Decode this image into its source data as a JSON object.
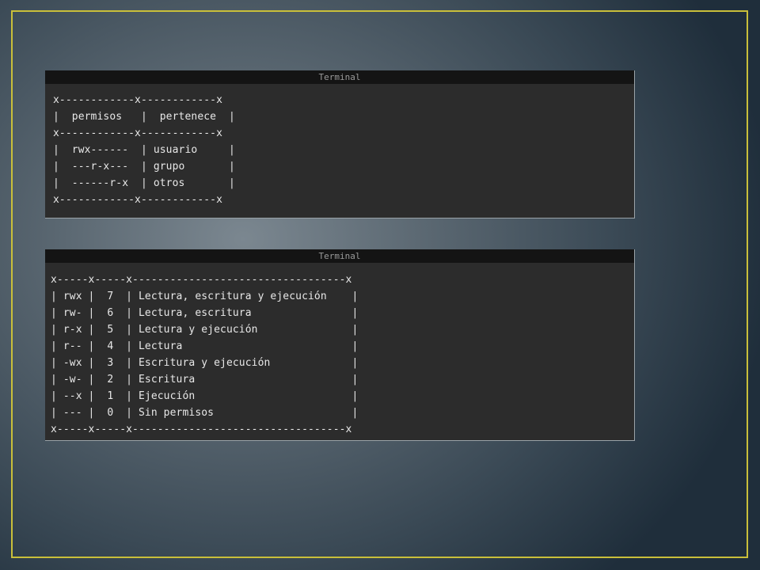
{
  "terminal_1": {
    "title": "Terminal",
    "lines": [
      "x------------x------------x",
      "|  permisos   |  pertenece  |",
      "x------------x------------x",
      "|  rwx------  | usuario     |",
      "|  ---r-x---  | grupo       |",
      "|  ------r-x  | otros       |",
      "x------------x------------x"
    ]
  },
  "terminal_2": {
    "title": "Terminal",
    "lines": [
      "x-----x-----x----------------------------------x",
      "| rwx |  7  | Lectura, escritura y ejecución    |",
      "| rw- |  6  | Lectura, escritura                |",
      "| r-x |  5  | Lectura y ejecución               |",
      "| r-- |  4  | Lectura                           |",
      "| -wx |  3  | Escritura y ejecución             |",
      "| -w- |  2  | Escritura                         |",
      "| --x |  1  | Ejecución                         |",
      "| --- |  0  | Sin permisos                      |",
      "x-----x-----x----------------------------------x"
    ]
  }
}
